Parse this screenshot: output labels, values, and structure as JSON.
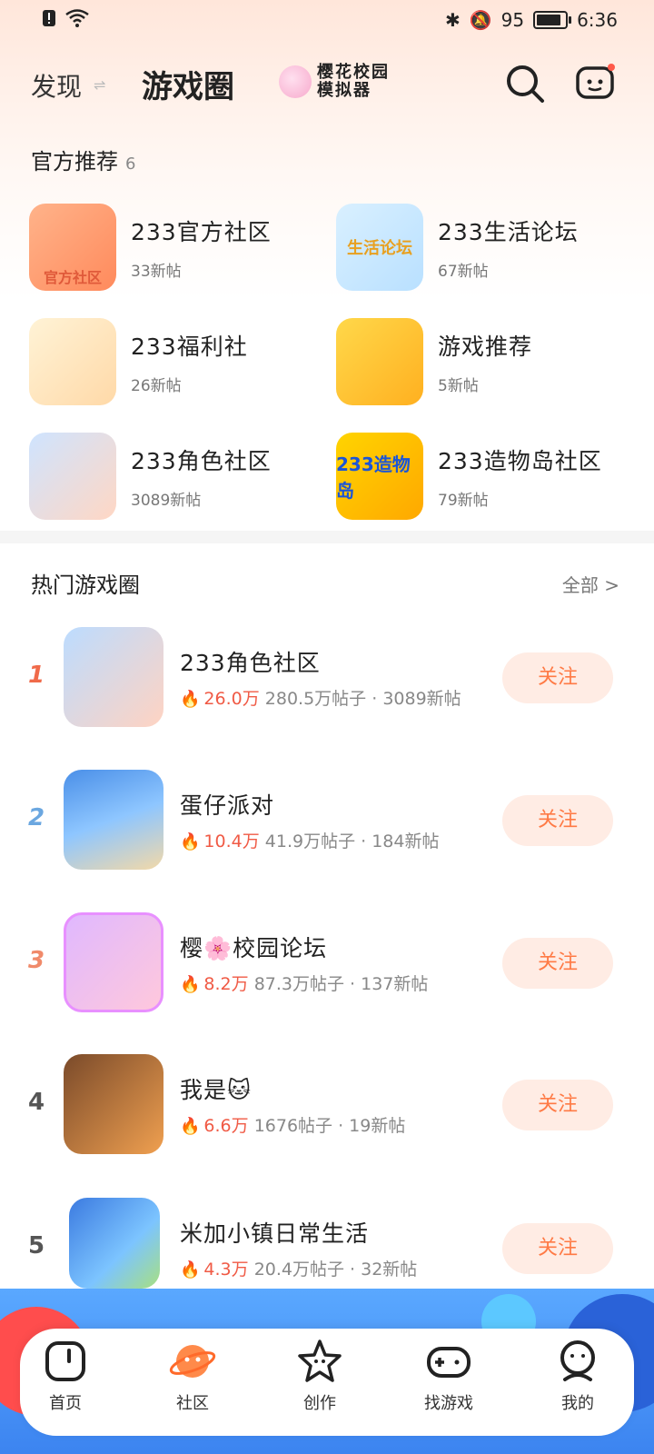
{
  "status_bar": {
    "battery_pct": "95",
    "time": "6:36"
  },
  "header": {
    "tab_find": "发现",
    "tab_circle": "游戏圈",
    "sakura_title": "樱花校园模拟器"
  },
  "official": {
    "title": "官方推荐",
    "count": "6",
    "items": [
      {
        "name": "233官方社区",
        "sub": "33新帖",
        "icon_text": "官方社区"
      },
      {
        "name": "233生活论坛",
        "sub": "67新帖",
        "icon_text": "生活论坛"
      },
      {
        "name": "233福利社",
        "sub": "26新帖",
        "icon_text": ""
      },
      {
        "name": "游戏推荐",
        "sub": "5新帖",
        "icon_text": ""
      },
      {
        "name": "233角色社区",
        "sub": "3089新帖",
        "icon_text": ""
      },
      {
        "name": "233造物岛社区",
        "sub": "79新帖",
        "icon_text": "233造物岛"
      }
    ]
  },
  "hot": {
    "title": "热门游戏圈",
    "all_label": "全部 >",
    "follow_label": "关注",
    "items": [
      {
        "rank": "1",
        "name": "233角色社区",
        "heat": "26.0万",
        "posts": "280.5万帖子",
        "new": "· 3089新帖",
        "rank_color": "#f06a4a"
      },
      {
        "rank": "2",
        "name": "蛋仔派对",
        "heat": "10.4万",
        "posts": "41.9万帖子",
        "new": "· 184新帖",
        "rank_color": "#6ba7e0"
      },
      {
        "rank": "3",
        "name": "樱🌸校园论坛",
        "heat": "8.2万",
        "posts": "87.3万帖子",
        "new": "· 137新帖",
        "rank_color": "#f08a6a"
      },
      {
        "rank": "4",
        "name": "我是🐱",
        "heat": "6.6万",
        "posts": "1676帖子",
        "new": "· 19新帖",
        "rank_color": "#555555"
      },
      {
        "rank": "5",
        "name": "米加小镇日常生活",
        "heat": "4.3万",
        "posts": "20.4万帖子",
        "new": "· 32新帖",
        "rank_color": "#555555"
      }
    ]
  },
  "tabbar": {
    "items": [
      {
        "label": "首页",
        "icon": "home-icon"
      },
      {
        "label": "社区",
        "icon": "planet-icon"
      },
      {
        "label": "创作",
        "icon": "star-icon"
      },
      {
        "label": "找游戏",
        "icon": "gamepad-icon"
      },
      {
        "label": "我的",
        "icon": "profile-icon"
      }
    ]
  }
}
